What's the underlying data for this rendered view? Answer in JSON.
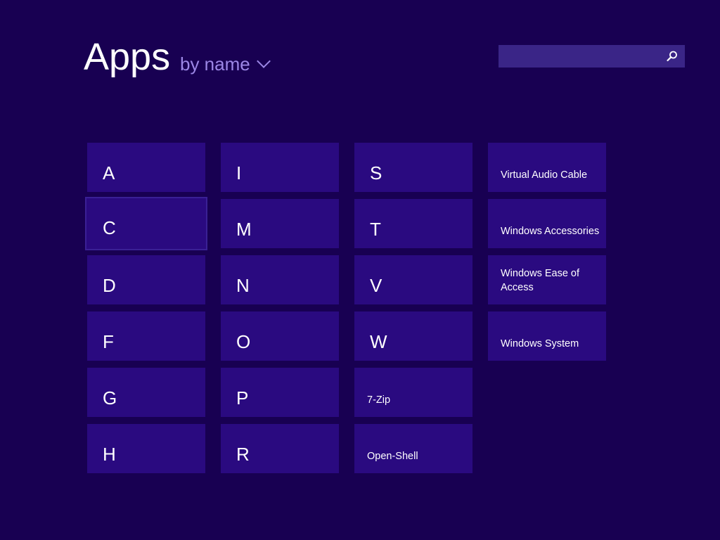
{
  "header": {
    "title": "Apps",
    "sort_label": "by name"
  },
  "search": {
    "placeholder": "",
    "value": ""
  },
  "colors": {
    "background": "#180052",
    "tile": "#2a0a80",
    "search_box": "#3a2587",
    "sort_text": "#9c87e6"
  },
  "groups": {
    "col1": [
      "A",
      "C",
      "D",
      "F",
      "G",
      "H"
    ],
    "col2": [
      "I",
      "M",
      "N",
      "O",
      "P",
      "R"
    ],
    "col3": [
      "S",
      "T",
      "V",
      "W"
    ]
  },
  "apps": {
    "seven_zip": "7-Zip",
    "open_shell": "Open-Shell",
    "virtual_audio_cable": "Virtual Audio Cable",
    "windows_accessories": "Windows Accessories",
    "windows_ease_of_access": "Windows Ease of Access",
    "windows_system": "Windows System"
  },
  "selected_group": "C"
}
